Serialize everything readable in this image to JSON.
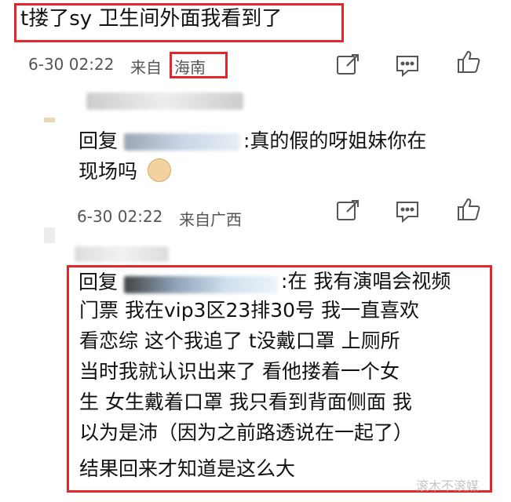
{
  "comment1": {
    "text": "t搂了sy 卫生间外面我看到了",
    "time": "6-30 02:22",
    "from_prefix": "来自",
    "location": "海南"
  },
  "reply1": {
    "prefix": "回复",
    "text_line1": ":真的假的呀姐妹你在",
    "text_line2": "现场吗",
    "time": "6-30 02:22",
    "from": "来自广西"
  },
  "reply2": {
    "prefix": "回复",
    "lines": [
      ":在  我有演唱会视频",
      "门票  我在vip3区23排30号  我一直喜欢",
      "看恋综  这个我追了  t没戴口罩  上厕所",
      "当时我就认识出来了  看他搂着一个女",
      "生  女生戴着口罩  我只看到背面侧面  我",
      "以为是沛（因为之前路透说在一起了）",
      "结果回来才知道是这么大"
    ]
  },
  "watermark": "滚木不滚媒",
  "icons": [
    "share-icon",
    "comment-icon",
    "like-icon"
  ]
}
